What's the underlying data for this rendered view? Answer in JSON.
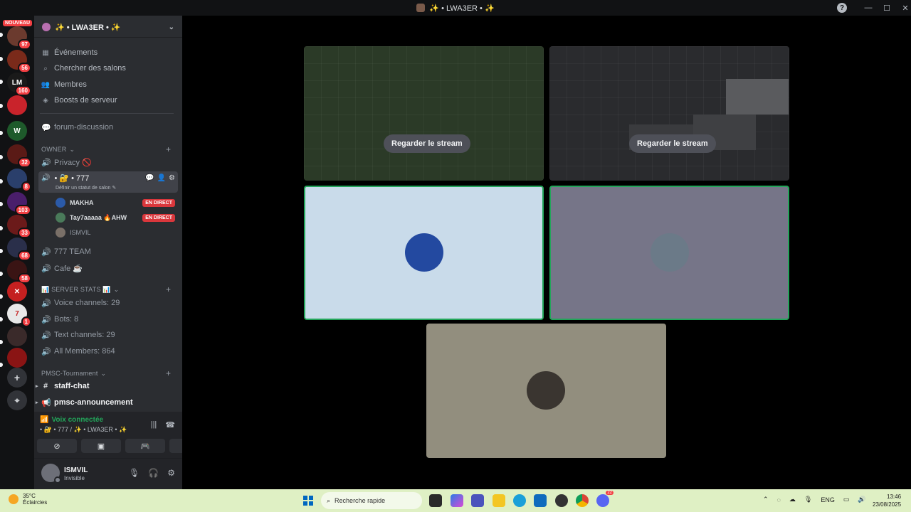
{
  "window": {
    "title": "✨ • LWA3ER • ✨",
    "help": "?",
    "minimize": "—",
    "maximize": "☐",
    "close": "✕"
  },
  "rail": {
    "new_badge": "NOUVEAU",
    "servers": [
      {
        "badge": "97",
        "color": "#6b3a2e"
      },
      {
        "badge": "56",
        "color": "#7a2a1a"
      },
      {
        "badge": "160",
        "color": "#1a1a1a",
        "glyph": "LM"
      },
      {
        "badge": "",
        "color": "#c9232b"
      },
      {
        "badge": "",
        "color": "#1e5a2b",
        "glyph": "W"
      },
      {
        "badge": "32",
        "color": "#5a1a16"
      },
      {
        "badge": "8",
        "color": "#2a3f6b"
      },
      {
        "badge": "103",
        "color": "#4a1e6b"
      },
      {
        "badge": "33",
        "color": "#6b1a1a"
      },
      {
        "badge": "68",
        "color": "#2a2f4a"
      },
      {
        "badge": "58",
        "color": "#3a1414"
      },
      {
        "badge": "",
        "color": "#c42020",
        "glyph": "✕"
      },
      {
        "badge": "1",
        "color": "#e8e8e8",
        "glyph": "7"
      },
      {
        "badge": "",
        "color": "#3a2a2a"
      },
      {
        "badge": "",
        "color": "#8a1414"
      }
    ],
    "add_icon": "+",
    "explore_icon": "⌖"
  },
  "sidebar": {
    "server_name": "✨ • LWA3ER • ✨",
    "nav": [
      {
        "icon": "calendar-icon",
        "glyph": "▦",
        "label": "Événements"
      },
      {
        "icon": "search-channels-icon",
        "glyph": "⌕",
        "label": "Chercher des salons"
      },
      {
        "icon": "members-icon",
        "glyph": "👥",
        "label": "Membres"
      },
      {
        "icon": "boost-icon",
        "glyph": "◈",
        "label": "Boosts de serveur"
      }
    ],
    "forum": "forum-discussion",
    "cat_owner": "OWNER",
    "privacy": "Privacy 🚫",
    "active_channel": "• 🔐 • 777",
    "active_status": "Définir un statut de salon ✎",
    "members": [
      {
        "name": "MAKHA",
        "live": "EN DIRECT",
        "color": "#2b5aa8"
      },
      {
        "name": "Tay7aaaaa 🔥AHW",
        "live": "EN DIRECT",
        "color": "#4a7a5a"
      },
      {
        "name": "ISMVIL",
        "live": "",
        "color": "#7a7068"
      }
    ],
    "ch_team": "777 TEAM",
    "ch_cafe": "Cafe ☕",
    "cat_stats": "📊 SERVER STATS 📊",
    "stats": [
      "Voice channels: 29",
      "Bots: 8",
      "Text channels: 29",
      "All Members: 864"
    ],
    "cat_pmsc": "PMSC-Tournament",
    "ch_staff": "staff-chat",
    "ch_announce": "pmsc-announcement"
  },
  "voice": {
    "status": "Voix connectée",
    "channel": "• 🔐 • 777 / ✨ • LWA3ER • ✨"
  },
  "user": {
    "name": "ISMVIL",
    "state": "Invisible"
  },
  "stage": {
    "watch_label": "Regarder le stream",
    "tiles": [
      {
        "type": "stream",
        "theme": "pitch"
      },
      {
        "type": "stream",
        "theme": "desktop"
      },
      {
        "type": "camera",
        "bg": "#c9dbea",
        "avatar": "#2349a0",
        "speaking": true
      },
      {
        "type": "camera",
        "bg": "#767588",
        "avatar": "#6b7a88",
        "speaking": true
      },
      {
        "type": "camera",
        "bg": "#928e7e",
        "avatar": "#3a3530",
        "speaking": false
      }
    ]
  },
  "taskbar": {
    "temp": "35°C",
    "weather": "Éclaircies",
    "search_placeholder": "Recherche rapide",
    "lang": "ENG",
    "time": "13:46",
    "date": "23/08/2025",
    "discord_badge": "22"
  }
}
